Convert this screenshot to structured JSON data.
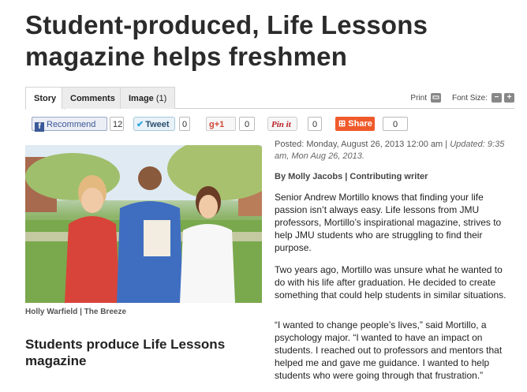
{
  "article": {
    "headline": "Student-produced, Life Lessons magazine helps freshmen",
    "tabs": [
      {
        "label": "Story",
        "count": ""
      },
      {
        "label": "Comments",
        "count": ""
      },
      {
        "label": "Image",
        "count": "(1)"
      }
    ],
    "tools": {
      "print_label": "Print",
      "font_size_label": "Font Size:",
      "minus": "−",
      "plus": "+"
    },
    "social": {
      "facebook_label": "Recommend",
      "facebook_count": "12",
      "twitter_label": "Tweet",
      "twitter_count": "0",
      "gplus_label": "+1",
      "gplus_count": "0",
      "pinterest_label": "Pin it",
      "pinterest_count": "0",
      "share_label": "Share",
      "share_count": "0"
    },
    "photo_caption": "Holly Warfield | The Breeze",
    "subhead": "Students produce Life Lessons magazine",
    "posted_label": "Posted: Monday, August 26, 2013 12:00 am |",
    "updated_label": "Updated: 9:35 am, Mon Aug 26, 2013.",
    "byline": "By Molly Jacobs | Contributing writer",
    "paragraphs": [
      "Senior Andrew Mortillo knows that finding your life passion isn’t always easy. Life lessons from JMU professors, Mortillo’s inspirational magazine, strives to help JMU students who are struggling to find their purpose.",
      "Two years ago, Mortillo was unsure what he wanted to do with his life after graduation. He decided to create something that could help students in similar situations.",
      "“I wanted to change people’s lives,” said Mortillo, a psychology major. “I wanted to have an impact on students. I reached out to professors and mentors that helped me and gave me guidance. I wanted to help students who were going through that frustration.”"
    ]
  },
  "icons": [
    "facebook-icon",
    "twitter-icon",
    "gplus-icon",
    "share-icon",
    "print-icon"
  ],
  "colors": {
    "share": "#f05a2a",
    "facebook": "#3b5998",
    "twitter": "#2da6e0",
    "gplus": "#d14836"
  }
}
